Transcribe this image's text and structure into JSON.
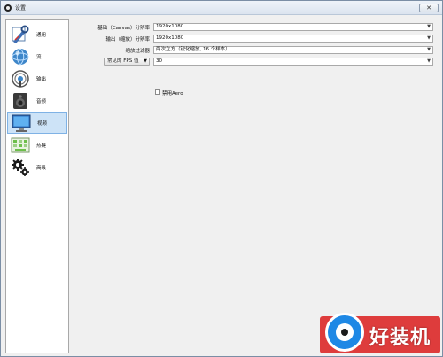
{
  "window": {
    "title": "设置",
    "close_glyph": "✕"
  },
  "sidebar": {
    "items": [
      {
        "label": "通用",
        "icon": "wrench-icon"
      },
      {
        "label": "流",
        "icon": "globe-icon"
      },
      {
        "label": "输出",
        "icon": "broadcast-icon"
      },
      {
        "label": "音频",
        "icon": "speaker-icon"
      },
      {
        "label": "视频",
        "icon": "monitor-icon",
        "active": true
      },
      {
        "label": "热键",
        "icon": "keyboard-icon"
      },
      {
        "label": "高级",
        "icon": "gears-icon"
      }
    ]
  },
  "video": {
    "base_resolution_label": "基础（Canvas）分辨率",
    "base_resolution_value": "1920x1080",
    "output_resolution_label": "输出（缩放）分辨率",
    "output_resolution_value": "1920x1080",
    "downscale_filter_label": "缩放过滤器",
    "downscale_filter_value": "两次立方（锐化缩放, 16 个样本）",
    "fps_type_label": "常见的 FPS 值",
    "fps_value": "30",
    "disable_aero_label": "禁用Aero",
    "disable_aero_checked": false
  },
  "watermark": {
    "text": "好装机"
  },
  "colors": {
    "active_bg": "#cde3f7",
    "active_border": "#7fb2e5",
    "watermark_red": "#dc2828",
    "watermark_blue": "#1e88e5"
  }
}
